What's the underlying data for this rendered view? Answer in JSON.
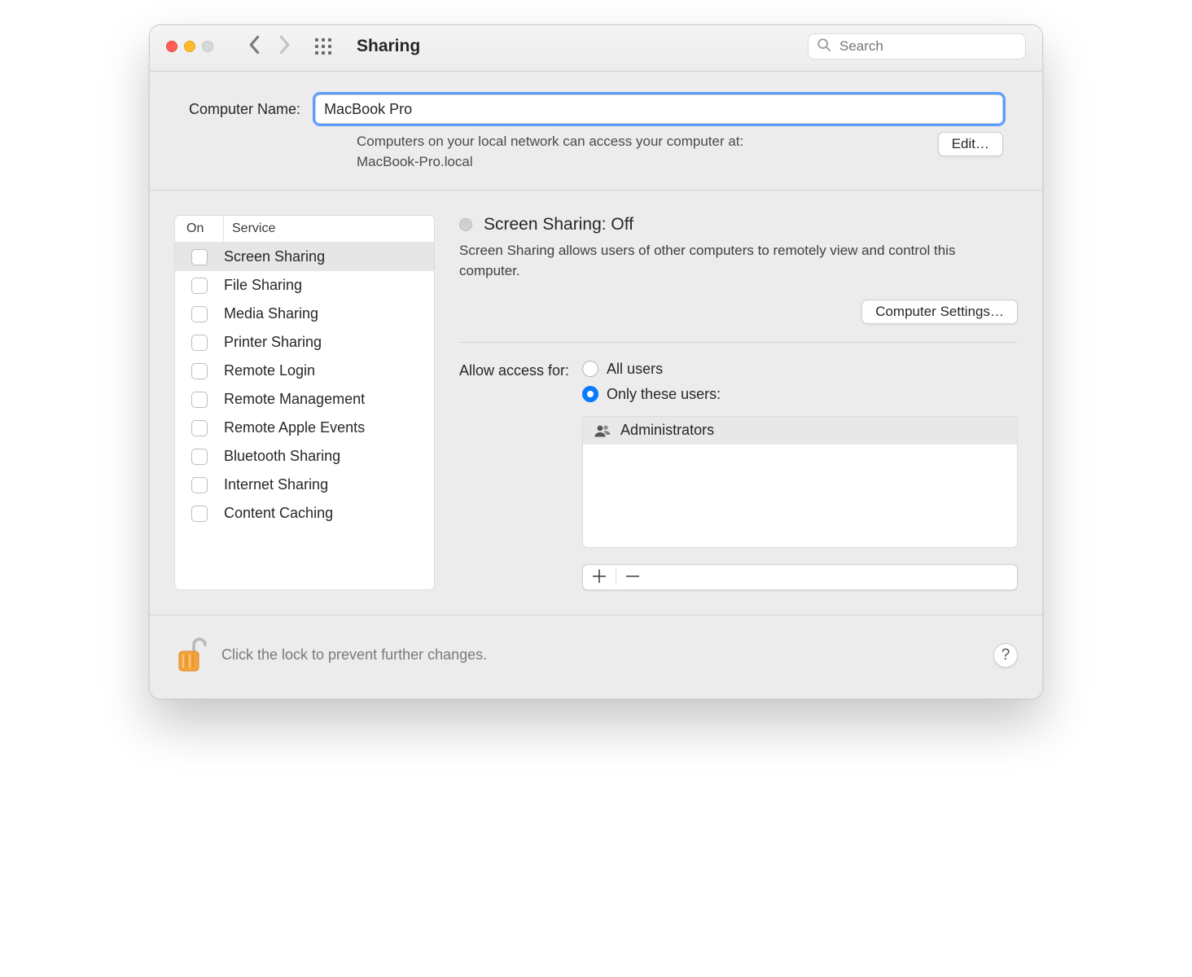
{
  "toolbar": {
    "title": "Sharing",
    "search_placeholder": "Search"
  },
  "computer_name": {
    "label": "Computer Name:",
    "value": "MacBook Pro",
    "access_text_line1": "Computers on your local network can access your computer at:",
    "access_text_line2": "MacBook-Pro.local",
    "edit_label": "Edit…"
  },
  "services": {
    "col_on": "On",
    "col_service": "Service",
    "items": [
      {
        "label": "Screen Sharing",
        "on": false,
        "selected": true
      },
      {
        "label": "File Sharing",
        "on": false,
        "selected": false
      },
      {
        "label": "Media Sharing",
        "on": false,
        "selected": false
      },
      {
        "label": "Printer Sharing",
        "on": false,
        "selected": false
      },
      {
        "label": "Remote Login",
        "on": false,
        "selected": false
      },
      {
        "label": "Remote Management",
        "on": false,
        "selected": false
      },
      {
        "label": "Remote Apple Events",
        "on": false,
        "selected": false
      },
      {
        "label": "Bluetooth Sharing",
        "on": false,
        "selected": false
      },
      {
        "label": "Internet Sharing",
        "on": false,
        "selected": false
      },
      {
        "label": "Content Caching",
        "on": false,
        "selected": false
      }
    ]
  },
  "detail": {
    "status_title": "Screen Sharing: Off",
    "status_desc": "Screen Sharing allows users of other computers to remotely view and control this computer.",
    "computer_settings_label": "Computer Settings…",
    "allow_label": "Allow access for:",
    "radio_all": "All users",
    "radio_only": "Only these users:",
    "selected_radio": "only",
    "users": [
      "Administrators"
    ]
  },
  "footer": {
    "lock_text": "Click the lock to prevent further changes.",
    "help_label": "?"
  }
}
